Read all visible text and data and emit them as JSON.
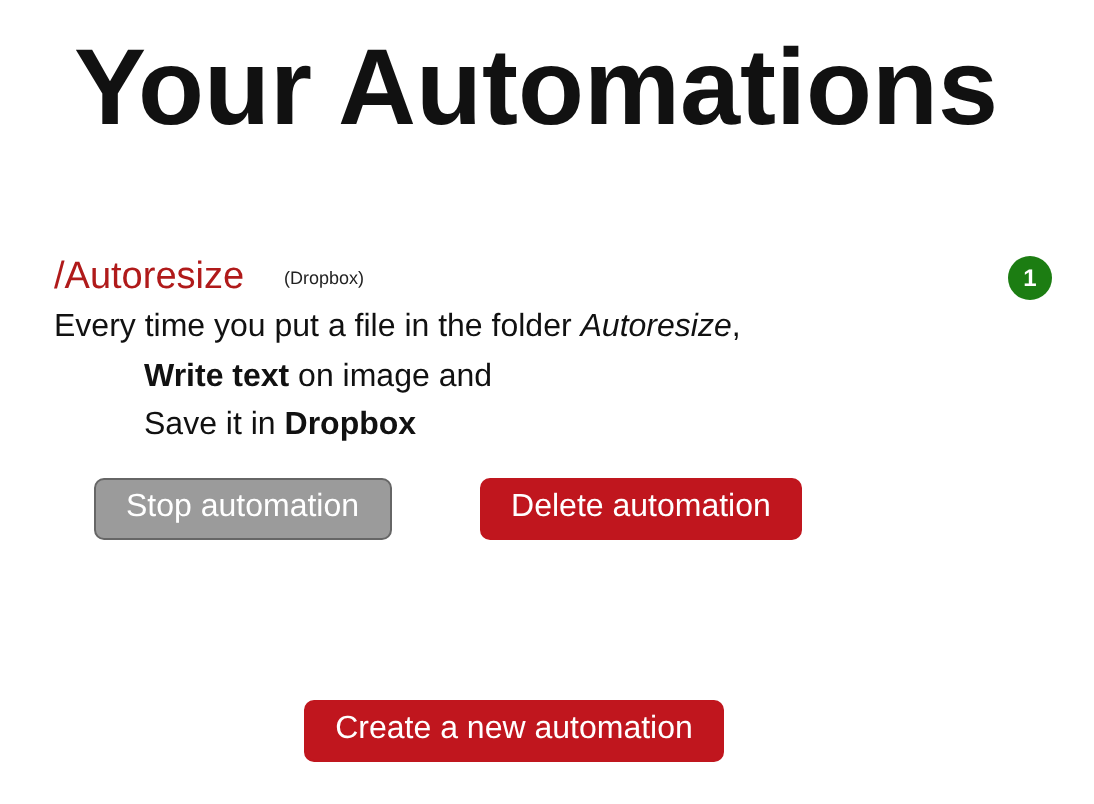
{
  "title": "Your Automations",
  "automations": [
    {
      "folder": "/Autoresize",
      "service": "(Dropbox)",
      "count": "1",
      "description": [
        "Every time you put a file in the folder *Autoresize*,",
        "**Write text** on image and",
        "Save it in **Dropbox**"
      ],
      "buttons": [
        {
          "label": "Stop automation",
          "kind": "stop"
        },
        {
          "label": "Delete automation",
          "kind": "delete"
        }
      ]
    }
  ],
  "create_button": "Create a new automation"
}
